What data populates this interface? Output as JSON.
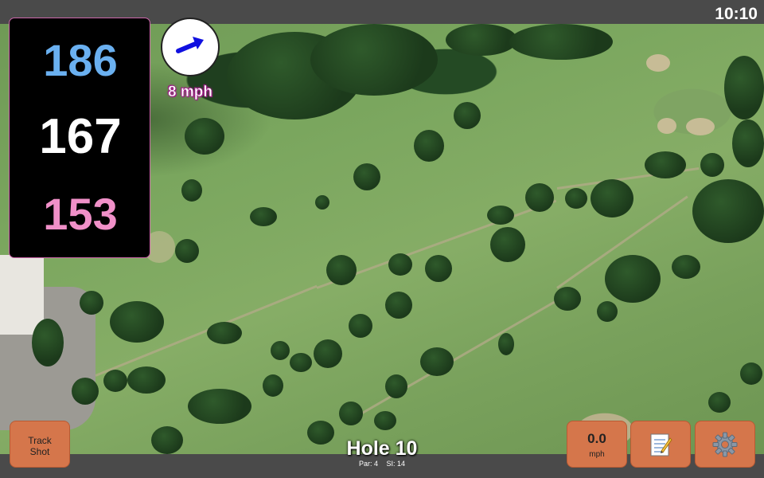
{
  "status": {
    "clock": "10:10"
  },
  "yardages": {
    "back": "186",
    "center": "167",
    "front": "153"
  },
  "wind": {
    "speed_label": "8 mph",
    "arrow_icon": "arrow-right-icon",
    "arrow_color": "#1010e0"
  },
  "hole": {
    "title": "Hole 10",
    "par_label": "Par: 4",
    "si_label": "SI: 14"
  },
  "buttons": {
    "track_shot_line1": "Track",
    "track_shot_line2": "Shot",
    "speed_value": "0.0",
    "speed_unit": "mph",
    "notes_icon": "notepad-icon",
    "settings_icon": "gear-icon"
  },
  "colors": {
    "back_yardage": "#6ab0f0",
    "center_yardage": "#ffffff",
    "front_yardage": "#f090c8",
    "button_bg": "#d5764b"
  }
}
